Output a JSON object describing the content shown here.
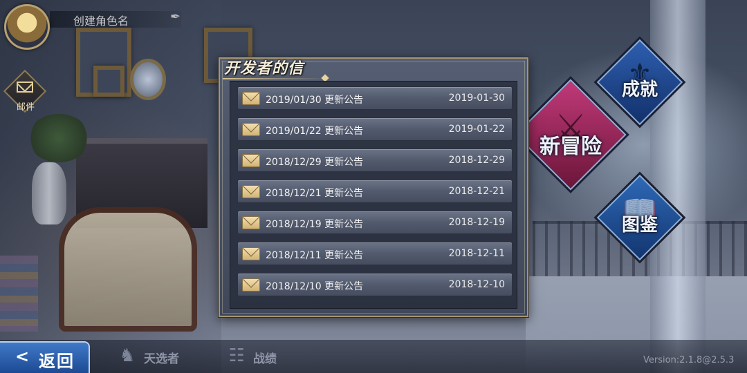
{
  "profile": {
    "name_placeholder": "创建角色名"
  },
  "mail": {
    "label": "邮件"
  },
  "menu": {
    "achievement": "成就",
    "new_adventure": "新冒险",
    "gallery": "图鉴"
  },
  "dialog": {
    "title": "开发者的信",
    "letters": [
      {
        "title": "2019/01/30 更新公告",
        "date": "2019-01-30"
      },
      {
        "title": "2019/01/22 更新公告",
        "date": "2019-01-22"
      },
      {
        "title": "2018/12/29 更新公告",
        "date": "2018-12-29"
      },
      {
        "title": "2018/12/21 更新公告",
        "date": "2018-12-21"
      },
      {
        "title": "2018/12/19 更新公告",
        "date": "2018-12-19"
      },
      {
        "title": "2018/12/11 更新公告",
        "date": "2018-12-11"
      },
      {
        "title": "2018/12/10 更新公告",
        "date": "2018-12-10"
      }
    ]
  },
  "bottom": {
    "back_arrow": "<",
    "back_label": "返回",
    "tab_chosen": "天选者",
    "tab_record": "战绩"
  },
  "version": "Version:2.1.8@2.5.3"
}
